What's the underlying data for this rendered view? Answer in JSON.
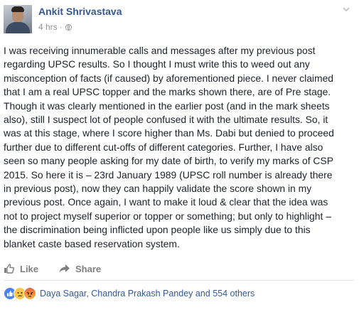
{
  "post": {
    "author_name": "Ankit Shrivastava",
    "timestamp": "4 hrs",
    "meta_separator": "·",
    "privacy_icon": "globe-icon",
    "menu_icon": "chevron-down-icon",
    "body": "I was receiving innumerable calls and messages after my previous post\nregarding UPSC results. So I thought I must write this to weed out any\nmisconception of facts (if caused) by aforementioned piece. I never claimed\nthat I am a real UPSC topper and the marks shown there, are of Pre stage.\nThough it was clearly mentioned in the earlier post (and in the mark sheets\nalso), still I suspect lot of people confused it with the ultimate results. So, it\nwas at this stage, where I score higher than Ms. Dabi but denied to proceed\nfurther due to different cut-offs of different categories. Further, I have also\nseen so many people asking for my date of birth, to verify my marks of CSP\n2015. So here it is – 23rd January 1989 (UPSC roll number is already there\nin previous post), now they can happily validate the score shown in my\nprevious post. Once again, I want to make it loud & clear that the idea was\nnot to project myself superior or topper or something; but only to highlight –\nthe discrimination being inflicted upon people like us simply due to this\nblanket caste based reservation system."
  },
  "actions": {
    "like_label": "Like",
    "share_label": "Share"
  },
  "reactions": {
    "icons": [
      "like-icon",
      "sad-icon",
      "angry-icon"
    ],
    "summary": "Daya Sagar, Chandra Prakash Pandey and 554 others"
  },
  "colors": {
    "author": "#365899",
    "meta": "#90949c",
    "body": "#1d2129",
    "actions": "#7f7f7f",
    "like_reaction": "#4a82f5"
  }
}
